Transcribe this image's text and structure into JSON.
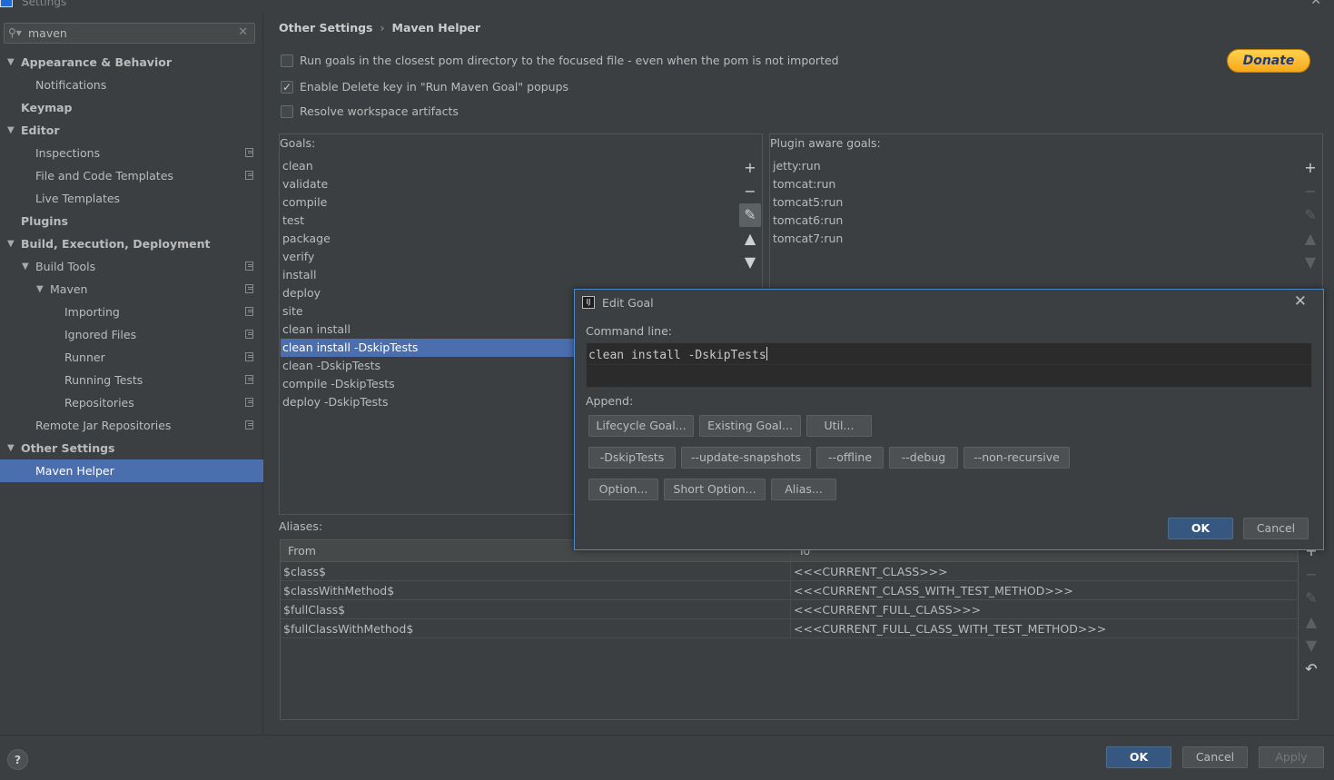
{
  "window": {
    "title": "Settings"
  },
  "search": {
    "value": "maven"
  },
  "tree": [
    {
      "label": "Appearance & Behavior",
      "level": 0,
      "bold": true,
      "arrow": "▼",
      "proj": false
    },
    {
      "label": "Notifications",
      "level": 1,
      "bold": false,
      "arrow": "",
      "proj": false
    },
    {
      "label": "Keymap",
      "level": 0,
      "bold": true,
      "arrow": "",
      "proj": false
    },
    {
      "label": "Editor",
      "level": 0,
      "bold": true,
      "arrow": "▼",
      "proj": false
    },
    {
      "label": "Inspections",
      "level": 1,
      "bold": false,
      "arrow": "",
      "proj": true
    },
    {
      "label": "File and Code Templates",
      "level": 1,
      "bold": false,
      "arrow": "",
      "proj": true
    },
    {
      "label": "Live Templates",
      "level": 1,
      "bold": false,
      "arrow": "",
      "proj": false
    },
    {
      "label": "Plugins",
      "level": 0,
      "bold": true,
      "arrow": "",
      "proj": false
    },
    {
      "label": "Build, Execution, Deployment",
      "level": 0,
      "bold": true,
      "arrow": "▼",
      "proj": false
    },
    {
      "label": "Build Tools",
      "level": 1,
      "bold": false,
      "arrow": "▼",
      "proj": true
    },
    {
      "label": "Maven",
      "level": 2,
      "bold": false,
      "arrow": "▼",
      "proj": true
    },
    {
      "label": "Importing",
      "level": 3,
      "bold": false,
      "arrow": "",
      "proj": true
    },
    {
      "label": "Ignored Files",
      "level": 3,
      "bold": false,
      "arrow": "",
      "proj": true
    },
    {
      "label": "Runner",
      "level": 3,
      "bold": false,
      "arrow": "",
      "proj": true
    },
    {
      "label": "Running Tests",
      "level": 3,
      "bold": false,
      "arrow": "",
      "proj": true
    },
    {
      "label": "Repositories",
      "level": 3,
      "bold": false,
      "arrow": "",
      "proj": true
    },
    {
      "label": "Remote Jar Repositories",
      "level": 1,
      "bold": false,
      "arrow": "",
      "proj": true
    },
    {
      "label": "Other Settings",
      "level": 0,
      "bold": true,
      "arrow": "▼",
      "proj": false
    },
    {
      "label": "Maven Helper",
      "level": 1,
      "bold": false,
      "arrow": "",
      "proj": false,
      "selected": true
    }
  ],
  "breadcrumb": {
    "parent": "Other Settings",
    "sep": "›",
    "current": "Maven Helper"
  },
  "options": {
    "run_goals": "Run goals in the closest pom directory to the focused file - even when the pom is not imported",
    "enable_delete": "Enable Delete key in \"Run Maven Goal\" popups",
    "resolve_workspace": "Resolve workspace artifacts"
  },
  "donate": "Donate",
  "goals": {
    "title": "Goals:",
    "items": [
      "clean",
      "validate",
      "compile",
      "test",
      "package",
      "verify",
      "install",
      "deploy",
      "site",
      "clean install",
      "clean install -DskipTests",
      "clean -DskipTests",
      "compile -DskipTests",
      "deploy -DskipTests"
    ],
    "selected": 10
  },
  "plugin_goals": {
    "title": "Plugin aware goals:",
    "items": [
      "jetty:run",
      "tomcat:run",
      "tomcat5:run",
      "tomcat6:run",
      "tomcat7:run"
    ]
  },
  "aliases": {
    "label": "Aliases:",
    "columns": [
      "From",
      "To"
    ],
    "rows": [
      [
        "$class$",
        "<<<CURRENT_CLASS>>>"
      ],
      [
        "$classWithMethod$",
        "<<<CURRENT_CLASS_WITH_TEST_METHOD>>>"
      ],
      [
        "$fullClass$",
        "<<<CURRENT_FULL_CLASS>>>"
      ],
      [
        "$fullClassWithMethod$",
        "<<<CURRENT_FULL_CLASS_WITH_TEST_METHOD>>>"
      ]
    ]
  },
  "dialog": {
    "title": "Edit Goal",
    "command_label": "Command line:",
    "command_value": "clean install -DskipTests",
    "append_label": "Append:",
    "buttons_row1": [
      "Lifecycle Goal...",
      "Existing Goal...",
      "Util..."
    ],
    "buttons_row2": [
      "-DskipTests",
      "--update-snapshots",
      "--offline",
      "--debug",
      "--non-recursive"
    ],
    "buttons_row3": [
      "Option...",
      "Short Option...",
      "Alias..."
    ],
    "ok": "OK",
    "cancel": "Cancel"
  },
  "footer": {
    "help": "?",
    "ok": "OK",
    "cancel": "Cancel",
    "apply": "Apply"
  }
}
